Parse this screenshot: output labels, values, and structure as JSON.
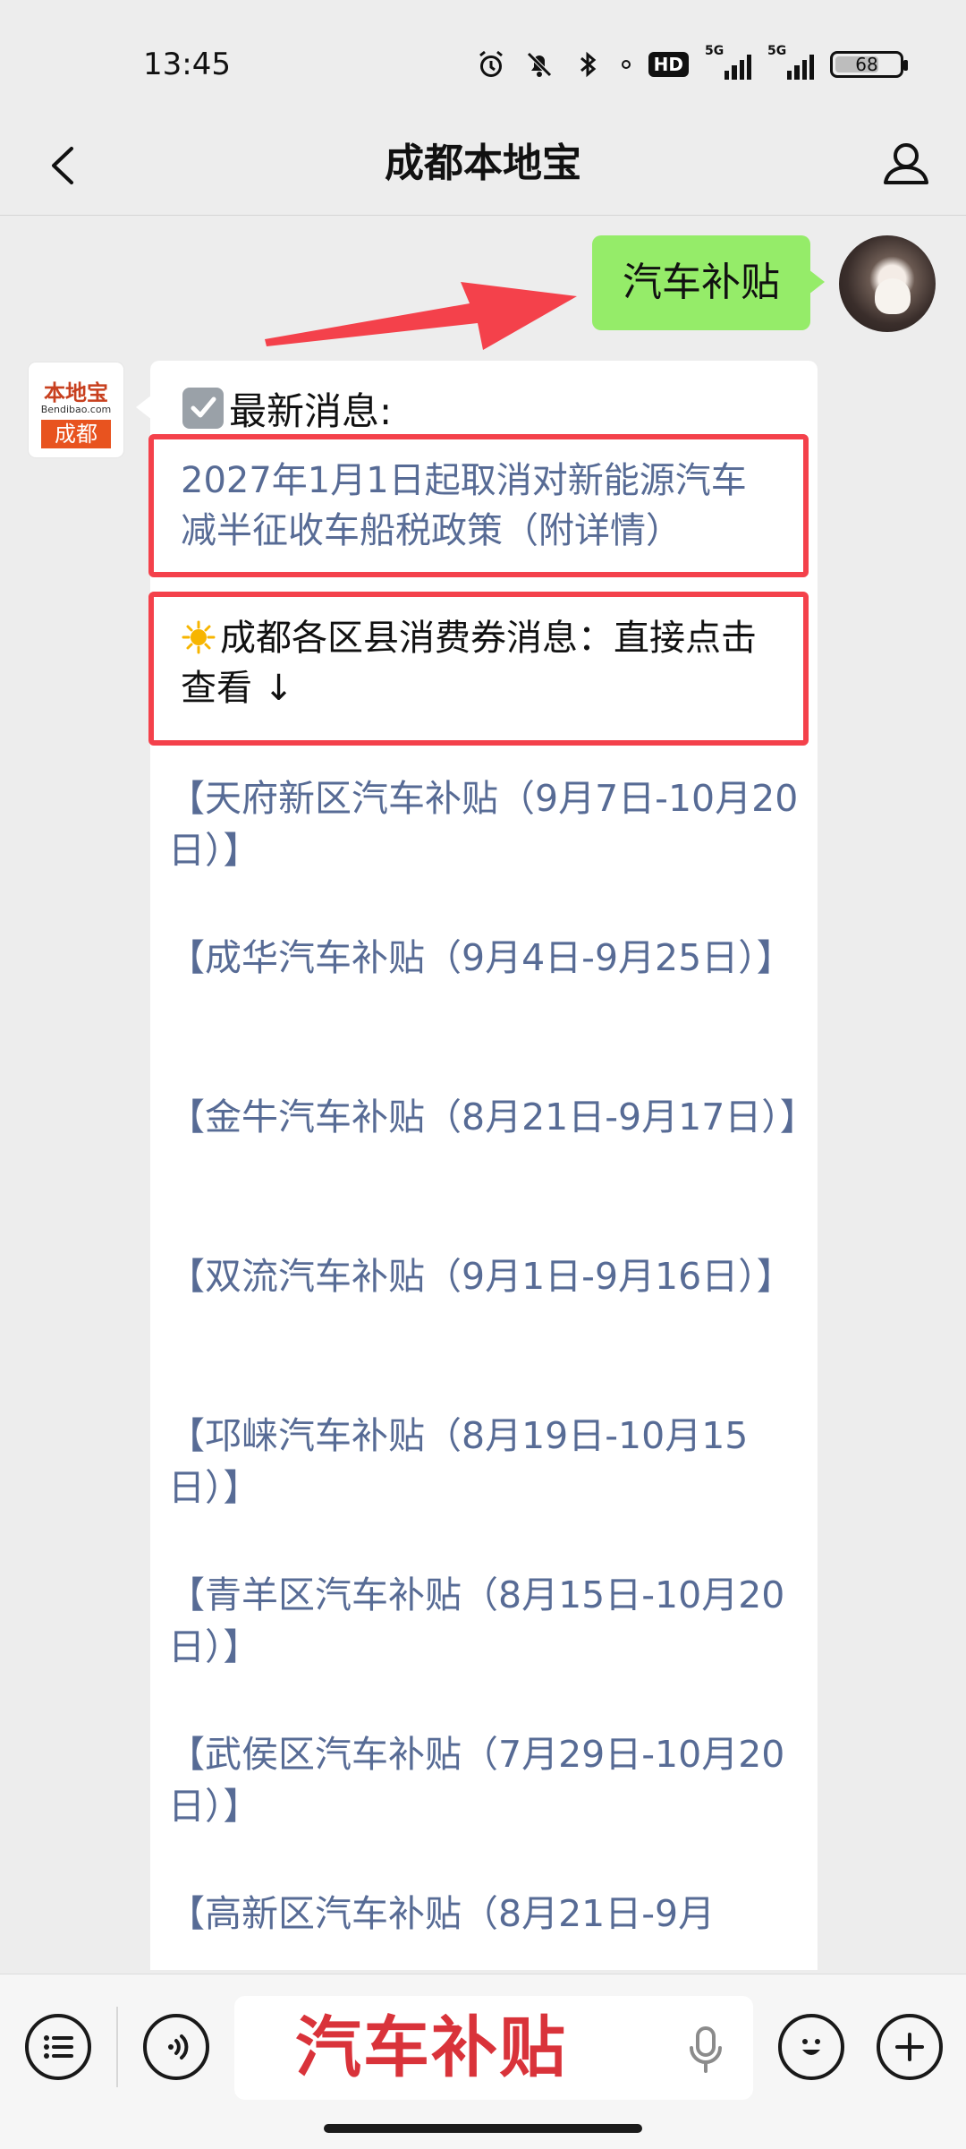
{
  "status_bar": {
    "time": "13:45",
    "network_1": "5G",
    "network_2": "5G",
    "hd_label": "HD",
    "battery": "68",
    "battery_level": 0.68,
    "icons": [
      "alarm-icon",
      "silent-bell-icon",
      "bluetooth-icon",
      "location-dot-icon"
    ]
  },
  "header": {
    "title": "成都本地宝",
    "back_icon": "chevron-left-icon",
    "profile_icon": "person-icon"
  },
  "chat": {
    "my_message": "汽车补贴",
    "bot_avatar": {
      "logo_top": "本地宝",
      "logo_url": "Bendibao.com",
      "logo_city": "成都"
    },
    "bot_reply": {
      "header": "最新消息:",
      "highlight_1": "2027年1月1日起取消对新能源汽车减半征收车船税政策（附详情）",
      "highlight_2": "成都各区县消费券消息：直接点击查看 ↓",
      "links": [
        "【天府新区汽车补贴（9月7日-10月20日）】",
        "【成华汽车补贴（9月4日-9月25日）】",
        "【金牛汽车补贴（8月21日-9月17日）】",
        "【双流汽车补贴（9月1日-9月16日）】",
        "【邛崃汽车补贴（8月19日-10月15日）】",
        "【青羊区汽车补贴（8月15日-10月20日）】",
        "【武侯区汽车补贴（7月29日-10月20日）】",
        "【高新区汽车补贴（8月21日-9月"
      ]
    }
  },
  "input_bar": {
    "text_value": "汽车补贴",
    "icons": [
      "list-menu-icon",
      "voice-icon",
      "microphone-icon",
      "emoji-icon",
      "plus-icon"
    ]
  },
  "colors": {
    "my_bubble": "#95ec69",
    "link": "#576b95",
    "highlight_border": "#f4414b",
    "input_text": "#d9333a"
  }
}
